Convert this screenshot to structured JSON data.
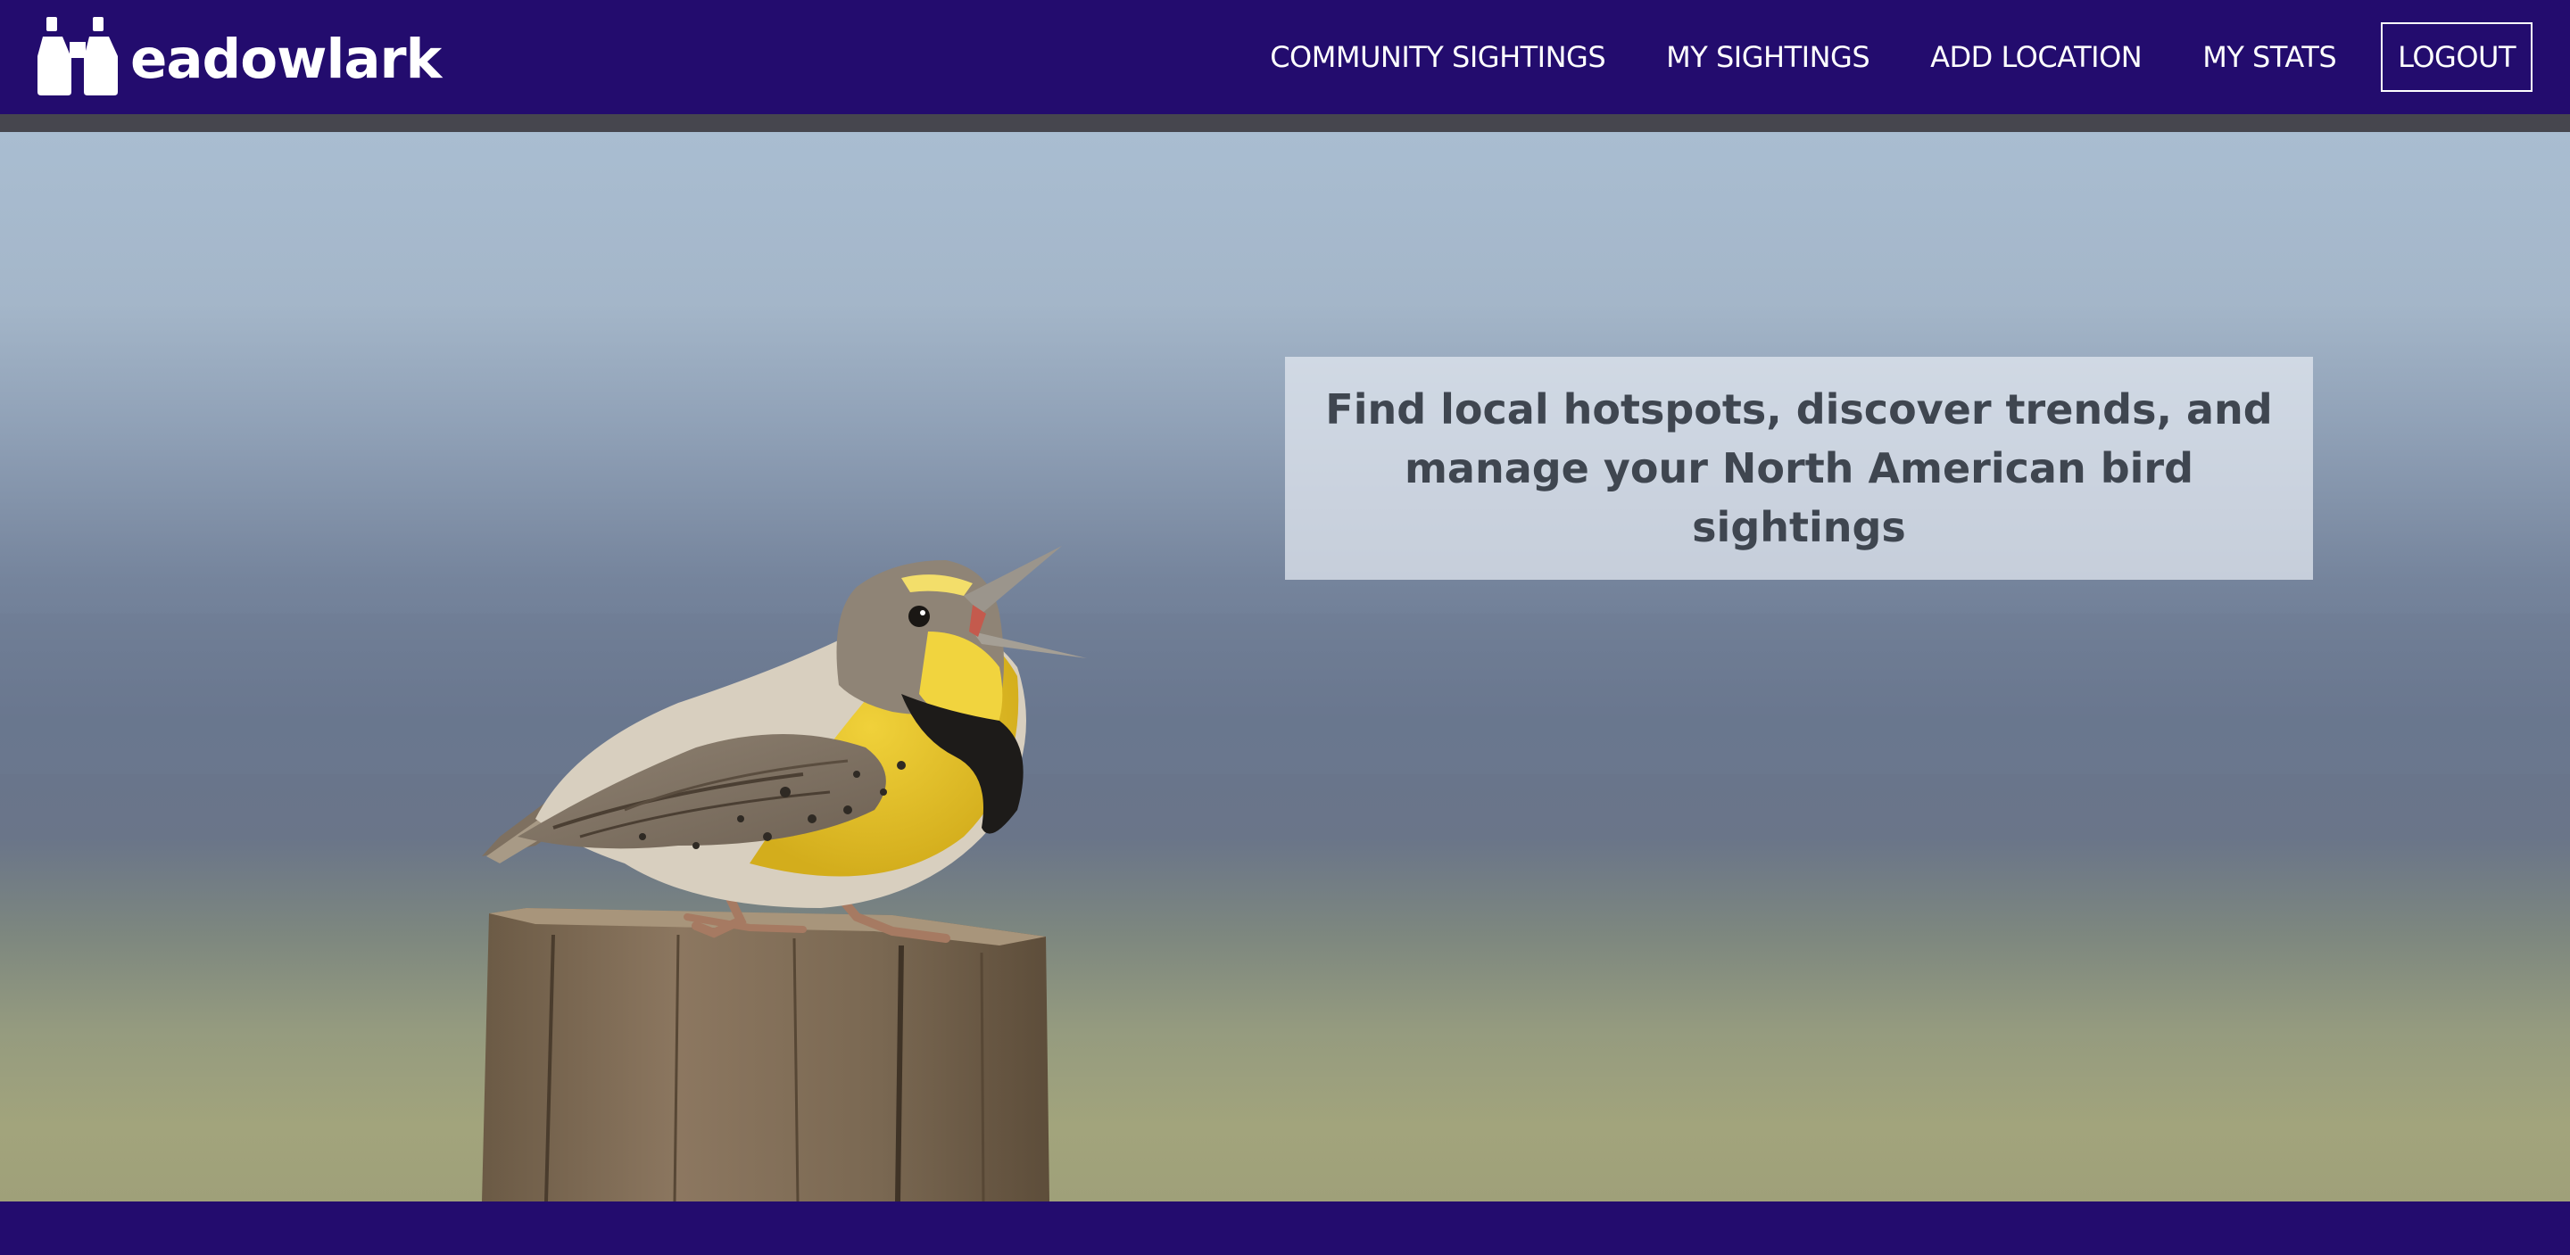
{
  "brand": {
    "name": "eadowlark",
    "logo_icon": "binoculars-icon"
  },
  "nav": {
    "community_sightings": "COMMUNITY SIGHTINGS",
    "my_sightings": "MY SIGHTINGS",
    "add_location": "ADD LOCATION",
    "my_stats": "MY STATS",
    "logout": "LOGOUT"
  },
  "hero": {
    "tagline": "Find local hotspots, discover trends, and manage your North American bird sightings",
    "image": "meadowlark-on-fence-post"
  },
  "colors": {
    "navbar": "#230c6e",
    "footer": "#230c6e",
    "tagline_text": "#3f4650"
  }
}
